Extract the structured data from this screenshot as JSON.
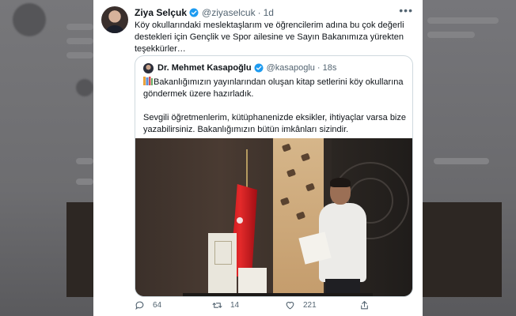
{
  "tweet": {
    "author_name": "Ziya Selçuk",
    "handle": "@ziyaselcuk",
    "separator": "·",
    "time": "1d",
    "text": "Köy okullarındaki meslektaşlarım ve öğrencilerim adına bu çok değerli destekleri için Gençlik ve Spor ailesine ve Sayın Bakanımıza yürekten teşekkürler…"
  },
  "quoted_tweet": {
    "author_name": "Dr. Mehmet Kasapoğlu",
    "handle": "@kasapoglu",
    "separator": "·",
    "time": "18s",
    "paragraph1": "Bakanlığımızın yayınlarından oluşan kitap setlerini köy okullarına göndermek üzere hazırladık.",
    "paragraph2": "Sevgili öğretmenlerim, kütüphanenizde eksikler, ihtiyaçlar varsa bize yazabilirsiniz. Bakanlığımızın bütün imkânları sizindir."
  },
  "actions": {
    "reply_count": "64",
    "retweet_count": "14",
    "like_count": "221"
  },
  "icons": [
    "verified-badge-icon",
    "more-icon",
    "books-icon",
    "reply-icon",
    "retweet-icon",
    "like-icon",
    "share-icon"
  ],
  "colors": {
    "verified": "#1d9bf0",
    "text_primary": "#0f1419",
    "text_secondary": "#536471",
    "border": "#cfd9de",
    "background_blur": "#6a6a6c"
  }
}
